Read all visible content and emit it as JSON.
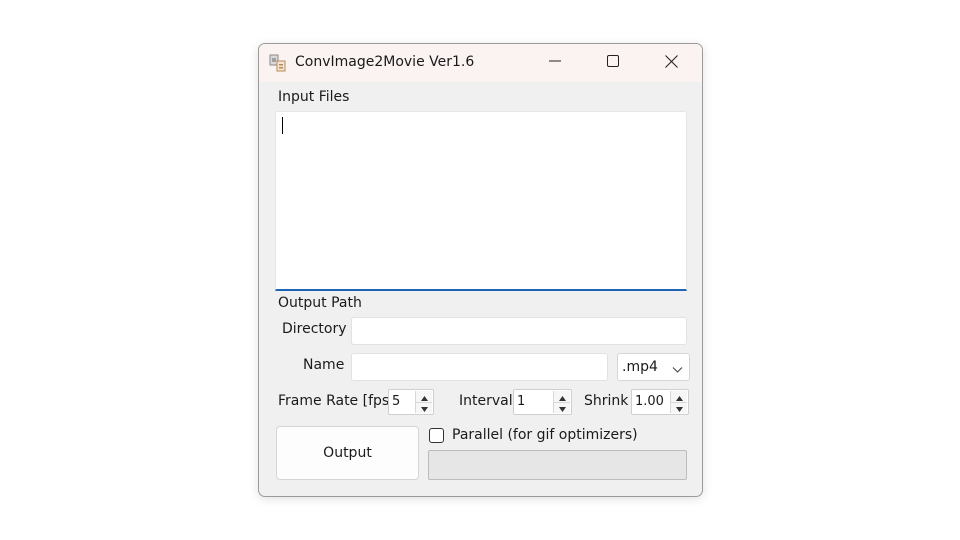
{
  "window": {
    "title": "ConvImage2Movie Ver1.6",
    "icon": "app-image-icon"
  },
  "title_controls": {
    "minimize": "minimize-icon",
    "maximize": "maximize-icon",
    "close": "close-icon"
  },
  "input_files": {
    "label": "Input Files",
    "value": ""
  },
  "output_path": {
    "label": "Output Path",
    "directory_label": "Directory",
    "directory_value": "",
    "name_label": "Name",
    "name_value": "",
    "extension_selected": ".mp4"
  },
  "settings": {
    "frame_rate_label": "Frame Rate [fps]",
    "frame_rate_value": "5",
    "interval_label": "Interval",
    "interval_value": "1",
    "shrink_label": "Shrink",
    "shrink_value": "1.00"
  },
  "actions": {
    "output_label": "Output",
    "parallel_label": "Parallel (for gif optimizers)",
    "parallel_checked": false,
    "progress_fraction": 0
  },
  "colors": {
    "accent": "#1e66b5",
    "titlebar": "#fbf3f1",
    "window_bg": "#f0f0f0"
  }
}
